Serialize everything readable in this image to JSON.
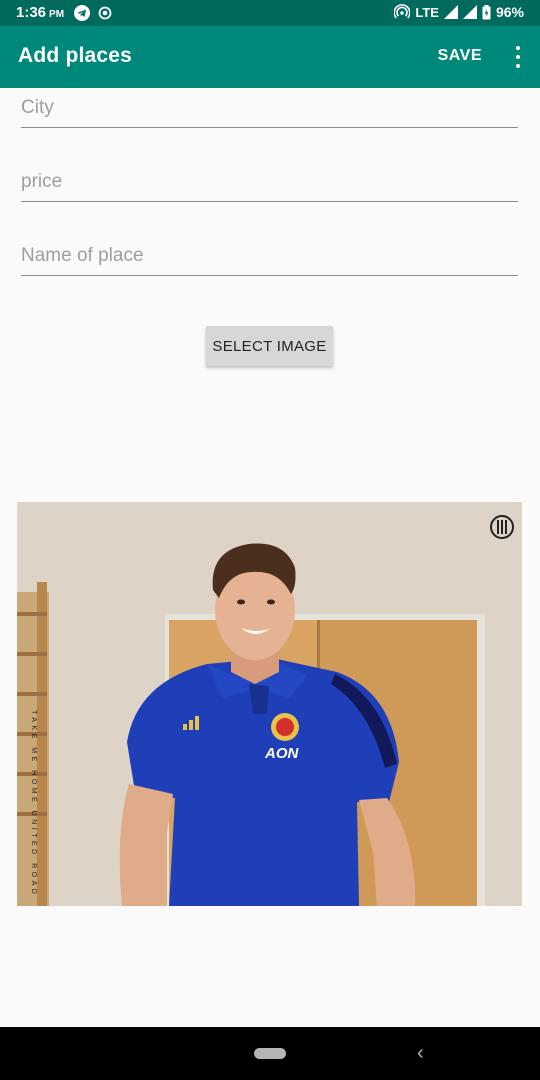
{
  "status": {
    "time": "1:36",
    "ampm": "PM",
    "network": "LTE",
    "battery": "96%"
  },
  "appbar": {
    "title": "Add places",
    "save_label": "SAVE",
    "overflow_icon": "more-vert-icon"
  },
  "form": {
    "city_placeholder": "City",
    "price_placeholder": "price",
    "name_placeholder": "Name of place",
    "select_image_label": "SELECT IMAGE"
  },
  "image": {
    "description_icon": "photo-image",
    "vertical_text": "TAKE ME HOME UNITED ROAD",
    "shirt_text": "AON"
  },
  "colors": {
    "statusbar": "#006b5d",
    "appbar": "#00897b",
    "background": "#fafafa",
    "button": "#d6d7d7"
  }
}
